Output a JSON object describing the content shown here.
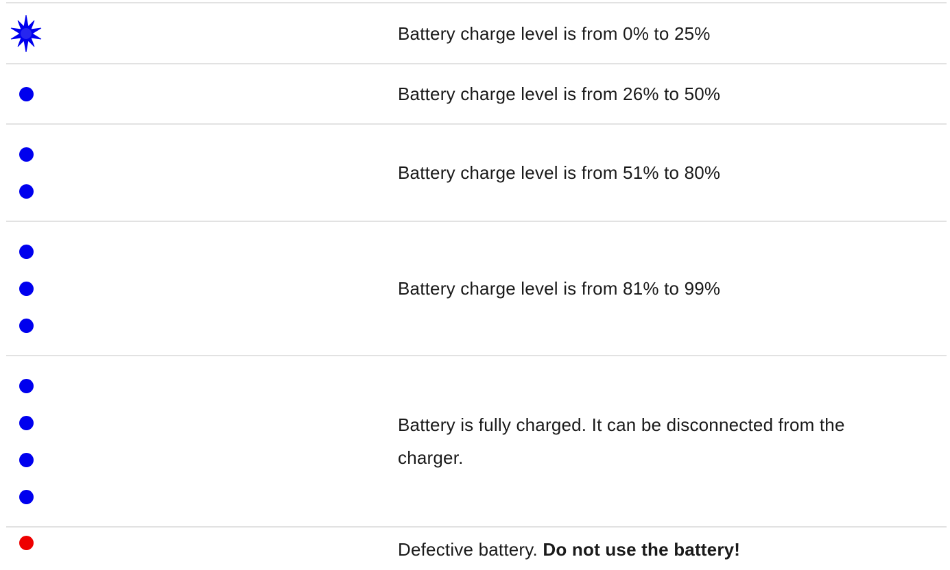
{
  "rows": [
    {
      "indicator": "blinking-blue-led-icon",
      "led_count": 1,
      "led_color": "#0000ee",
      "text": "Battery charge level is from 0% to 25%"
    },
    {
      "indicator": "blue-led-icon",
      "led_count": 1,
      "led_color": "#0000ee",
      "text": "Battery charge level is from 26% to 50%"
    },
    {
      "indicator": "blue-led-icon",
      "led_count": 2,
      "led_color": "#0000ee",
      "text": "Battery charge level is from 51% to 80%"
    },
    {
      "indicator": "blue-led-icon",
      "led_count": 3,
      "led_color": "#0000ee",
      "text": "Battery charge level is from 81% to 99%"
    },
    {
      "indicator": "blue-led-icon",
      "led_count": 4,
      "led_color": "#0000ee",
      "text": "Battery is fully charged. It can be disconnected from the charger."
    },
    {
      "indicator": "red-led-icon",
      "led_count": 1,
      "led_color": "#ee0000",
      "text": "Defective battery. ",
      "text_bold": "Do not use the battery!"
    }
  ],
  "colors": {
    "divider": "#e2e2e2",
    "text": "#1a1a1a"
  }
}
